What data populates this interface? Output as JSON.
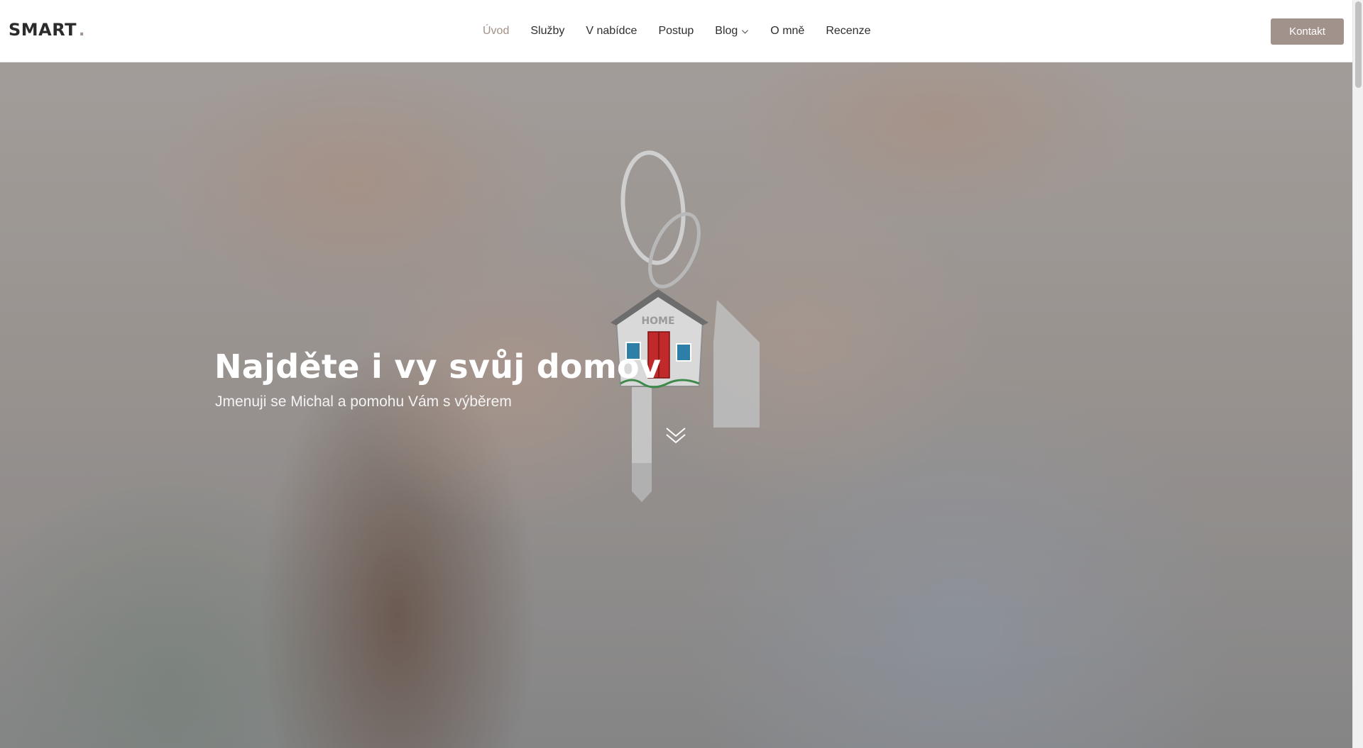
{
  "brand": {
    "name": "SMART",
    "dot": "."
  },
  "nav": {
    "items": [
      {
        "label": "Úvod",
        "active": true
      },
      {
        "label": "Služby"
      },
      {
        "label": "V nabídce"
      },
      {
        "label": "Postup"
      },
      {
        "label": "Blog",
        "has_dropdown": true
      },
      {
        "label": "O mně"
      },
      {
        "label": "Recenze"
      }
    ],
    "cta_label": "Kontakt"
  },
  "hero": {
    "title": "Najděte i vy svůj domov",
    "subtitle": "Jmenuji se Michal a pomohu Vám s výběrem",
    "keychain_text": "HOME",
    "scroll_icon": "double-chevron-down-icon"
  },
  "colors": {
    "accent": "#a1938b",
    "active_nav": "#a39187",
    "text": "#2e2e2e"
  }
}
